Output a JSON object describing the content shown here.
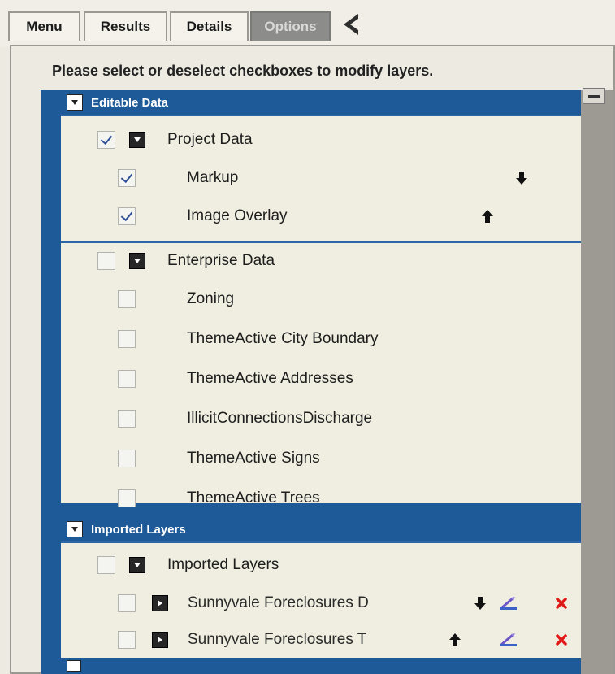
{
  "tabs": [
    {
      "label": "Menu",
      "active": false
    },
    {
      "label": "Results",
      "active": false
    },
    {
      "label": "Details",
      "active": false
    },
    {
      "label": "Options",
      "active": true
    }
  ],
  "instruction": "Please select or deselect checkboxes to modify layers.",
  "groups": {
    "editable": {
      "title": "Editable Data",
      "project": {
        "label": "Project Data",
        "checked": true,
        "items": [
          {
            "label": "Markup",
            "checked": true,
            "action": "move-down"
          },
          {
            "label": "Image Overlay",
            "checked": true,
            "action": "move-up"
          }
        ]
      },
      "enterprise": {
        "label": "Enterprise Data",
        "checked": false,
        "items": [
          {
            "label": "Zoning",
            "checked": false
          },
          {
            "label": "ThemeActive City Boundary",
            "checked": false
          },
          {
            "label": "ThemeActive Addresses",
            "checked": false
          },
          {
            "label": "IllicitConnectionsDischarge",
            "checked": false
          },
          {
            "label": "ThemeActive Signs",
            "checked": false
          },
          {
            "label": "ThemeActive Trees",
            "checked": false
          }
        ]
      }
    },
    "imported": {
      "title": "Imported Layers",
      "sub": {
        "label": "Imported Layers",
        "checked": false,
        "items": [
          {
            "label": "Sunnyvale Foreclosures D",
            "checked": false,
            "action": "move-down"
          },
          {
            "label": "Sunnyvale Foreclosures T",
            "checked": false,
            "action": "move-up"
          }
        ]
      }
    }
  },
  "colors": {
    "header": "#1e5a98",
    "body": "#f0eee0",
    "delete": "#e01818"
  }
}
